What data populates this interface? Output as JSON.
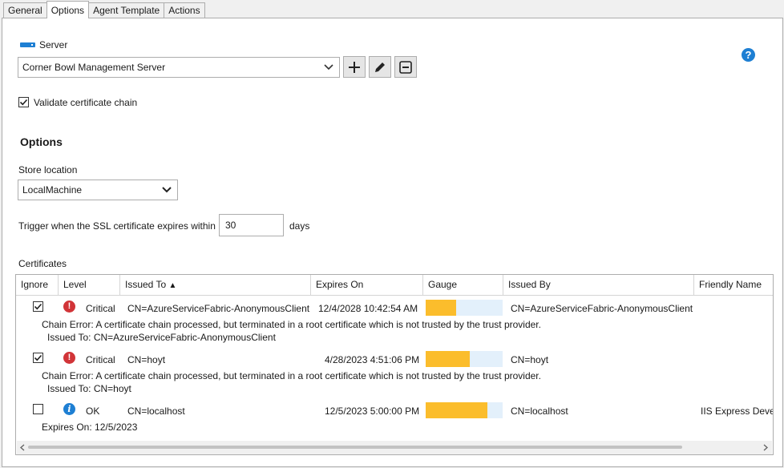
{
  "tabs": [
    "General",
    "Options",
    "Agent Template",
    "Actions"
  ],
  "active_tab": "Options",
  "server": {
    "label": "Server",
    "selected": "Corner Bowl Management Server"
  },
  "validate_chain": {
    "label": "Validate certificate chain",
    "checked": true
  },
  "options_heading": "Options",
  "store_location": {
    "label": "Store location",
    "selected": "LocalMachine"
  },
  "trigger": {
    "label": "Trigger when the SSL certificate expires within",
    "value": "30",
    "unit": "days"
  },
  "certificates": {
    "label": "Certificates",
    "columns": [
      "Ignore",
      "Level",
      "Issued To",
      "Expires On",
      "Gauge",
      "Issued By",
      "Friendly Name"
    ],
    "sort_indicator": "▲",
    "rows": [
      {
        "ignore": true,
        "level": "Critical",
        "severity": "critical",
        "issued_to": "CN=AzureServiceFabric-AnonymousClient",
        "expires_on": "12/4/2028 10:42:54 AM",
        "gauge": 0.4,
        "issued_by": "CN=AzureServiceFabric-AnonymousClient",
        "friendly_name": "",
        "detail1": "Chain Error: A certificate chain processed, but terminated in a root certificate which is not trusted by the trust provider.",
        "detail2": "Issued To: CN=AzureServiceFabric-AnonymousClient"
      },
      {
        "ignore": true,
        "level": "Critical",
        "severity": "critical",
        "issued_to": "CN=hoyt",
        "expires_on": "4/28/2023 4:51:06 PM",
        "gauge": 0.57,
        "issued_by": "CN=hoyt",
        "friendly_name": "",
        "detail1": "Chain Error: A certificate chain processed, but terminated in a root certificate which is not trusted by the trust provider.",
        "detail2": "Issued To: CN=hoyt"
      },
      {
        "ignore": false,
        "level": "OK",
        "severity": "info",
        "issued_to": "CN=localhost",
        "expires_on": "12/5/2023 5:00:00 PM",
        "gauge": 0.8,
        "issued_by": "CN=localhost",
        "friendly_name": "IIS Express Devel",
        "detail1": "Expires On: 12/5/2023",
        "detail2": ""
      }
    ]
  },
  "colors": {
    "accent": "#1e7fd3",
    "critical": "#d13438",
    "gauge_fill": "#fbbd2c",
    "gauge_bg": "#e3f0fb"
  }
}
